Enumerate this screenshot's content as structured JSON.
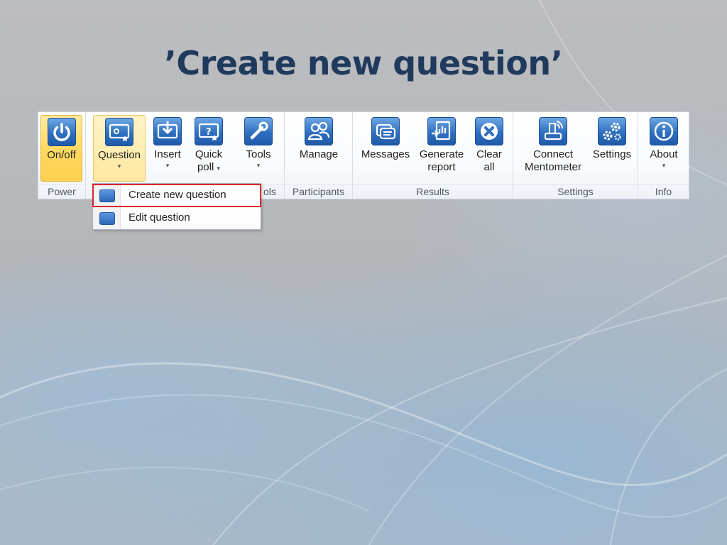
{
  "slide": {
    "title": "’Create new question’"
  },
  "ribbon": {
    "groups": [
      {
        "label": "Power",
        "buttons": [
          {
            "label": "On/off"
          }
        ]
      },
      {
        "label": "ols",
        "buttons": [
          {
            "label": "Question"
          },
          {
            "label": "Insert"
          },
          {
            "label_line1": "Quick",
            "label_line2": "poll"
          },
          {
            "label": "Tools"
          }
        ]
      },
      {
        "label": "Participants",
        "buttons": [
          {
            "label": "Manage"
          }
        ]
      },
      {
        "label": "Results",
        "buttons": [
          {
            "label": "Messages"
          },
          {
            "label_line1": "Generate",
            "label_line2": "report"
          },
          {
            "label_line1": "Clear",
            "label_line2": "all"
          }
        ]
      },
      {
        "label": "Settings",
        "buttons": [
          {
            "label_line1": "Connect",
            "label_line2": "Mentometer"
          },
          {
            "label": "Settings"
          }
        ]
      },
      {
        "label": "Info",
        "buttons": [
          {
            "label": "About"
          }
        ]
      }
    ],
    "caret": "▾"
  },
  "dropdown": {
    "items": [
      {
        "label": "Create new question",
        "highlighted": true
      },
      {
        "label": "Edit question",
        "highlighted": false
      }
    ]
  },
  "colors": {
    "title": "#1f3a5c",
    "active_button": "#ffd85e",
    "icon_blue": "#2f6fc0",
    "highlight_border": "#d9262c"
  },
  "icons": {
    "on_off": "power-icon",
    "question": "question-screen-icon",
    "insert": "insert-download-icon",
    "quick_poll": "quick-poll-icon",
    "tools": "wrench-icon",
    "manage": "participants-icon",
    "messages": "messages-icon",
    "generate_report": "report-icon",
    "clear_all": "clear-x-icon",
    "connect": "connect-device-icon",
    "settings": "gears-icon",
    "about": "info-icon"
  }
}
